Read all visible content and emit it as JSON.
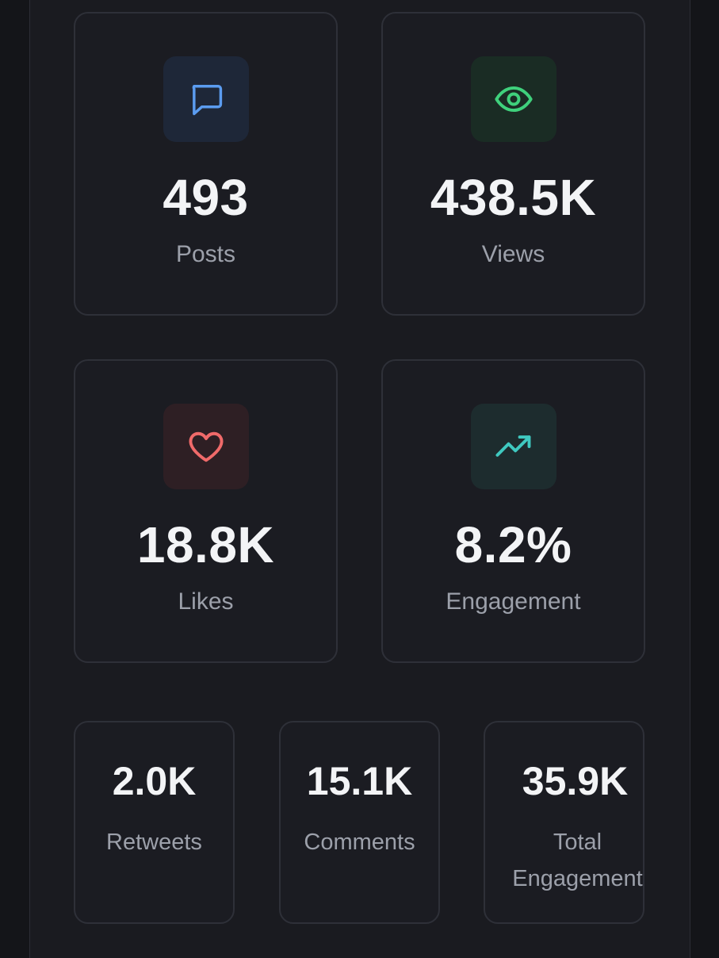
{
  "stats": [
    {
      "icon": "message-icon",
      "value": "493",
      "label": "Posts",
      "accent": "#5b9cf0",
      "tile_bg": "#1e2738"
    },
    {
      "icon": "eye-icon",
      "value": "438.5K",
      "label": "Views",
      "accent": "#3fd17c",
      "tile_bg": "#1a2c24"
    },
    {
      "icon": "heart-icon",
      "value": "18.8K",
      "label": "Likes",
      "accent": "#f06a6a",
      "tile_bg": "#2e1f24"
    },
    {
      "icon": "trending-up-icon",
      "value": "8.2%",
      "label": "Engagement",
      "accent": "#3fc9c0",
      "tile_bg": "#1d2c2e"
    }
  ],
  "secondary": [
    {
      "value": "2.0K",
      "label": "Retweets"
    },
    {
      "value": "15.1K",
      "label": "Comments"
    },
    {
      "value": "35.9K",
      "label": "Total Engagement"
    }
  ]
}
